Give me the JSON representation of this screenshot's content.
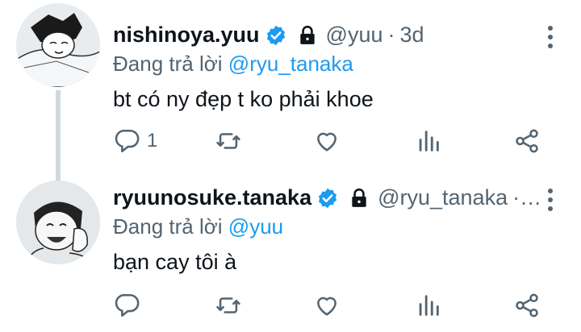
{
  "tweets": [
    {
      "name": "nishinoya.yuu",
      "handle": "@yuu",
      "separator": "·",
      "time": "3d",
      "reply_prefix": "Đang trả lời",
      "reply_mention": "@ryu_tanaka",
      "text": "bt có ny đẹp t ko phải khoe",
      "reply_count": "1"
    },
    {
      "name": "ryuunosuke.tanaka",
      "handle": "@ryu_tanaka",
      "separator": "·…",
      "reply_prefix": "Đang trả lời",
      "reply_mention": "@yuu",
      "text": "bạn cay tôi à",
      "reply_count": ""
    }
  ],
  "colors": {
    "text": "#0f1419",
    "secondary": "#536471",
    "accent": "#1d9bf0",
    "thread_line": "#cfd9de"
  },
  "icons": [
    "verified-badge-icon",
    "lock-icon",
    "more-icon",
    "reply-icon",
    "retweet-icon",
    "like-icon",
    "views-icon",
    "share-icon"
  ]
}
